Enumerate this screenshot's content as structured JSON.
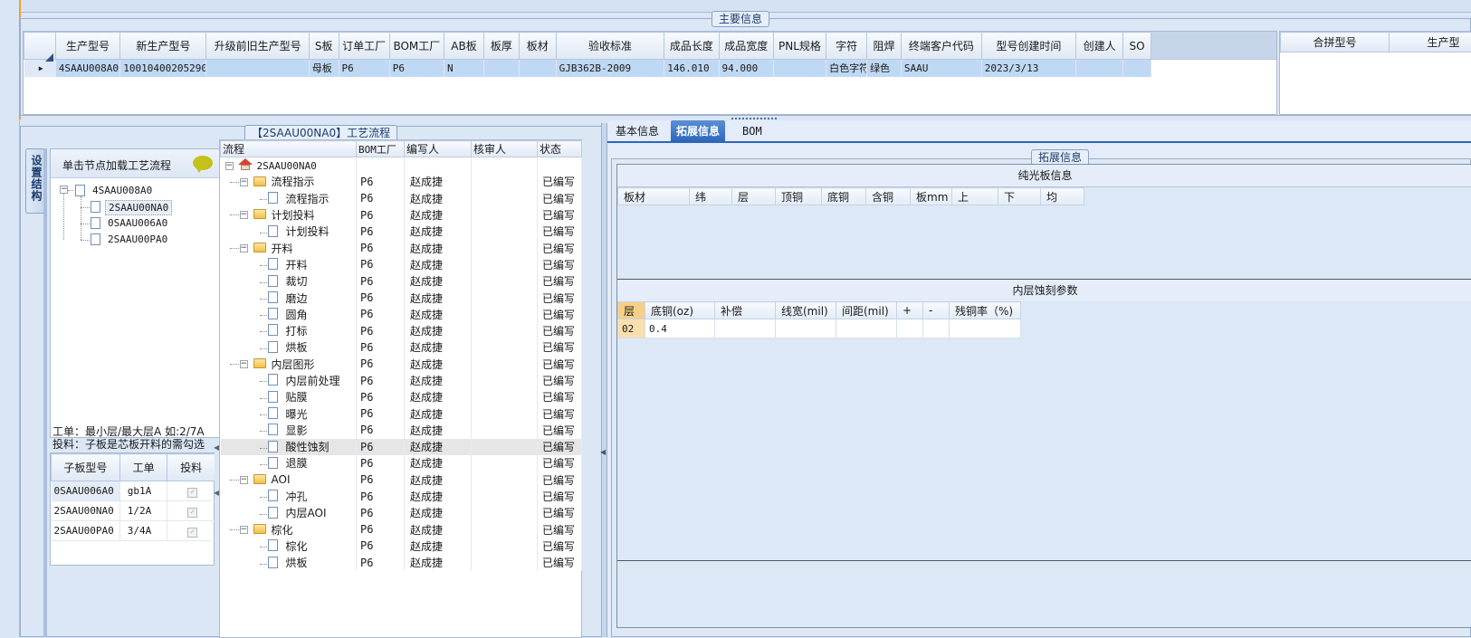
{
  "main_group_title": "主要信息",
  "main_columns": [
    "生产型号",
    "新生产型号",
    "升级前旧生产型号",
    "S板",
    "订单工厂",
    "BOM工厂",
    "AB板",
    "板厚",
    "板材",
    "验收标准",
    "成品长度",
    "成品宽度",
    "PNL规格",
    "字符",
    "阻焊",
    "终端客户代码",
    "型号创建时间",
    "创建人",
    "SO"
  ],
  "main_row": [
    "4SAAU008A0",
    "10010400205290",
    "",
    "母板",
    "P6",
    "P6",
    "N",
    "",
    "",
    "GJB362B-2009",
    "146.010",
    "94.000",
    "",
    "白色字符",
    "绿色",
    "SAAU",
    "2023/3/13",
    "",
    ""
  ],
  "right_columns": [
    "合拼型号",
    "生产型"
  ],
  "process_group_title": "【2SAAU00NA0】工艺流程",
  "side_tab": "设置结构",
  "load_hint": "单击节点加载工艺流程",
  "struct_tree": {
    "root": "4SAAU008A0",
    "children": [
      "2SAAU00NA0",
      "0SAAU006A0",
      "2SAAU00PA0"
    ]
  },
  "notes": [
    "工单：最小层/最大层A 如:2/7A",
    "投料：子板是芯板开料的需勾选"
  ],
  "sub_columns": [
    "子板型号",
    "工单",
    "投料"
  ],
  "sub_rows": [
    [
      "0SAAU006A0",
      "gb1A"
    ],
    [
      "2SAAU00NA0",
      "1/2A"
    ],
    [
      "2SAAU00PA0",
      "3/4A"
    ]
  ],
  "flow_columns": [
    "流程",
    "BOM工厂",
    "编写人",
    "核审人",
    "状态"
  ],
  "flow_root": "2SAAU00NA0",
  "flow": [
    {
      "name": "流程指示",
      "level": 1,
      "folder": true
    },
    {
      "name": "流程指示",
      "level": 2
    },
    {
      "name": "计划投料",
      "level": 1,
      "folder": true
    },
    {
      "name": "计划投料",
      "level": 2
    },
    {
      "name": "开料",
      "level": 1,
      "folder": true
    },
    {
      "name": "开料",
      "level": 2
    },
    {
      "name": "裁切",
      "level": 2
    },
    {
      "name": "磨边",
      "level": 2
    },
    {
      "name": "圆角",
      "level": 2
    },
    {
      "name": "打标",
      "level": 2
    },
    {
      "name": "烘板",
      "level": 2
    },
    {
      "name": "内层图形",
      "level": 1,
      "folder": true
    },
    {
      "name": "内层前处理",
      "level": 2
    },
    {
      "name": "贴膜",
      "level": 2
    },
    {
      "name": "曝光",
      "level": 2
    },
    {
      "name": "显影",
      "level": 2
    },
    {
      "name": "酸性蚀刻",
      "level": 2,
      "selected": true
    },
    {
      "name": "退膜",
      "level": 2
    },
    {
      "name": "AOI",
      "level": 1,
      "folder": true
    },
    {
      "name": "冲孔",
      "level": 2
    },
    {
      "name": "内层AOI",
      "level": 2
    },
    {
      "name": "棕化",
      "level": 1,
      "folder": true
    },
    {
      "name": "棕化",
      "level": 2
    },
    {
      "name": "烘板",
      "level": 2
    }
  ],
  "flow_values": {
    "bom": "P6",
    "writer": "赵成捷",
    "status": "已编写"
  },
  "tabs": [
    "基本信息",
    "拓展信息",
    "BOM"
  ],
  "ext_group_title": "拓展信息",
  "plain_title": "纯光板信息",
  "plain_columns": [
    "板材",
    "纬",
    "层",
    "顶铜",
    "底铜",
    "含铜",
    "板mm",
    "上",
    "下",
    "均"
  ],
  "etch_title": "内层蚀刻参数",
  "etch_columns": [
    "层",
    "底铜(oz)",
    "补偿",
    "线宽(mil)",
    "间距(mil)",
    "+",
    "-",
    "残铜率（%)"
  ],
  "etch_row": [
    "02",
    "0.4",
    "",
    "",
    "",
    "",
    "",
    ""
  ]
}
